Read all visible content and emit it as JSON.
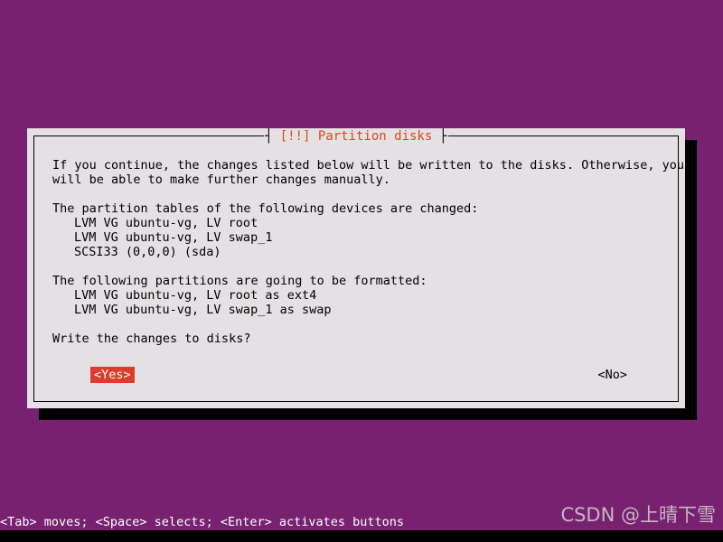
{
  "screen": {
    "background_color": "#77216f",
    "bottom_bar_color": "#000000"
  },
  "dialog": {
    "title": "[!!] Partition disks",
    "title_color": "#dd4814",
    "background_color": "#e4e0e4",
    "border_color": "#000000",
    "title_bracket_left": "┤",
    "title_bracket_right": "├",
    "paragraphs": {
      "intro_line_1": "If you continue, the changes listed below will be written to the disks. Otherwise, you",
      "intro_line_2": "will be able to make further changes manually.",
      "changed_heading": "The partition tables of the following devices are changed:",
      "changed_items": [
        "LVM VG ubuntu-vg, LV root",
        "LVM VG ubuntu-vg, LV swap_1",
        "SCSI33 (0,0,0) (sda)"
      ],
      "format_heading": "The following partitions are going to be formatted:",
      "format_items": [
        "LVM VG ubuntu-vg, LV root as ext4",
        "LVM VG ubuntu-vg, LV swap_1 as swap"
      ],
      "question": "Write the changes to disks?"
    },
    "buttons": {
      "yes": {
        "label": "<Yes>",
        "selected": true,
        "background_color": "#dd3b2b",
        "text_color": "#ffffff"
      },
      "no": {
        "label": "<No>",
        "selected": false,
        "background_color": "transparent",
        "text_color": "#000000"
      }
    }
  },
  "statusbar": {
    "hint": "<Tab> moves; <Space> selects; <Enter> activates buttons",
    "text_color": "#ffffff"
  },
  "watermark": {
    "text": "CSDN @上晴下雪"
  }
}
